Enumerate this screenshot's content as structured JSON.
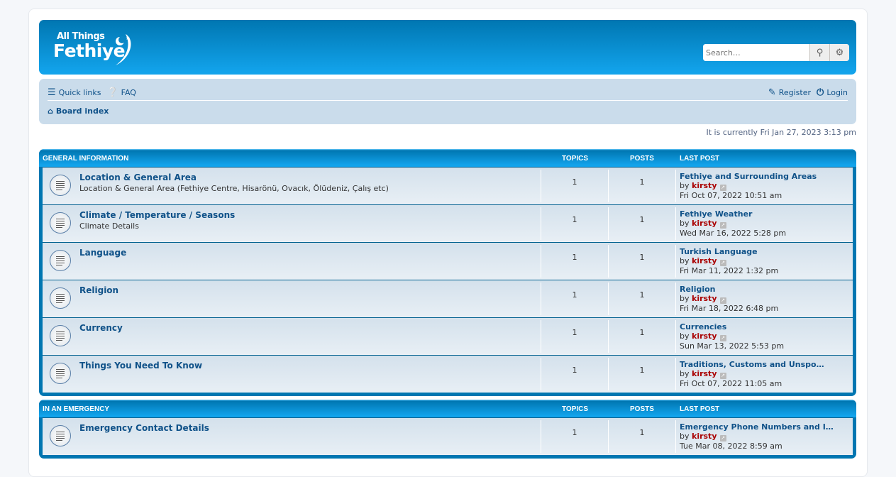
{
  "header": {
    "logo_line1": "All Things",
    "logo_line2": "Fethiye",
    "search_placeholder": "Search…",
    "search_icon": "search-icon",
    "settings_icon": "gear-icon"
  },
  "navbar": {
    "quick_links": "Quick links",
    "faq": "FAQ",
    "register": "Register",
    "login": "Login",
    "board_index": "Board index"
  },
  "current_time": "It is currently Fri Jan 27, 2023 3:13 pm",
  "colors": {
    "header": "#0076b1",
    "navbar": "#cadceb",
    "link": "#105289",
    "username": "#aa0000"
  },
  "categories": [
    {
      "name": "General Information",
      "topics_label": "Topics",
      "posts_label": "Posts",
      "last_post_label": "Last post",
      "forums": [
        {
          "title": "Location & General Area",
          "desc": "Location & General Area (Fethiye Centre, Hisarönü, Ovacık, Ölüdeniz, Çalış etc)",
          "topics": "1",
          "posts": "1",
          "last_title": "Fethiye and Surrounding Areas",
          "by": "by",
          "user": "kirsty",
          "date": "Fri Oct 07, 2022 10:51 am"
        },
        {
          "title": "Climate / Temperature / Seasons",
          "desc": "Climate Details",
          "topics": "1",
          "posts": "1",
          "last_title": "Fethiye Weather",
          "by": "by",
          "user": "kirsty",
          "date": "Wed Mar 16, 2022 5:28 pm"
        },
        {
          "title": "Language",
          "desc": "",
          "topics": "1",
          "posts": "1",
          "last_title": "Turkish Language",
          "by": "by",
          "user": "kirsty",
          "date": "Fri Mar 11, 2022 1:32 pm"
        },
        {
          "title": "Religion",
          "desc": "",
          "topics": "1",
          "posts": "1",
          "last_title": "Religion",
          "by": "by",
          "user": "kirsty",
          "date": "Fri Mar 18, 2022 6:48 pm"
        },
        {
          "title": "Currency",
          "desc": "",
          "topics": "1",
          "posts": "1",
          "last_title": "Currencies",
          "by": "by",
          "user": "kirsty",
          "date": "Sun Mar 13, 2022 5:53 pm"
        },
        {
          "title": "Things You Need To Know",
          "desc": "",
          "topics": "1",
          "posts": "1",
          "last_title": "Traditions, Customs and Unspo…",
          "by": "by",
          "user": "kirsty",
          "date": "Fri Oct 07, 2022 11:05 am"
        }
      ]
    },
    {
      "name": "In an Emergency",
      "topics_label": "Topics",
      "posts_label": "Posts",
      "last_post_label": "Last post",
      "forums": [
        {
          "title": "Emergency Contact Details",
          "desc": "",
          "topics": "1",
          "posts": "1",
          "last_title": "Emergency Phone Numbers and I…",
          "by": "by",
          "user": "kirsty",
          "date": "Tue Mar 08, 2022 8:59 am"
        }
      ]
    }
  ]
}
